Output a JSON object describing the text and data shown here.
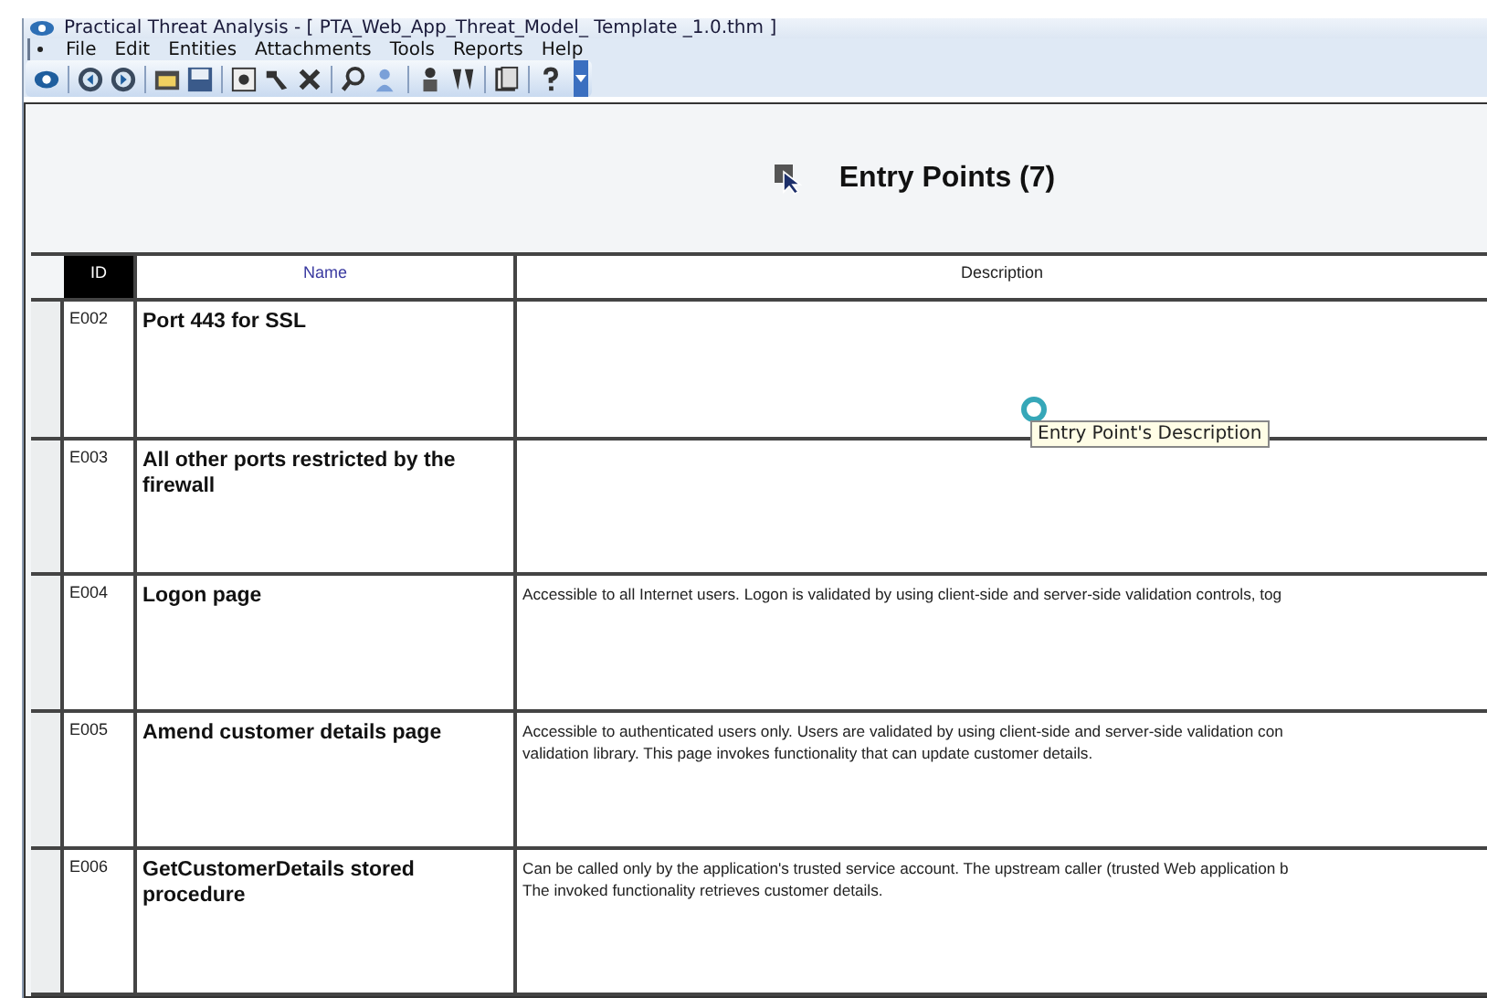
{
  "window": {
    "title": "Practical Threat Analysis - [ PTA_Web_App_Threat_Model_ Template _1.0.thm ]"
  },
  "menu": [
    "File",
    "Edit",
    "Entities",
    "Attachments",
    "Tools",
    "Reports",
    "Help"
  ],
  "panel": {
    "title": "Entry Points (7)"
  },
  "table": {
    "columns": [
      {
        "label": "ID",
        "selected": true
      },
      {
        "label": "Name",
        "selected": false
      },
      {
        "label": "Description",
        "selected": false
      }
    ],
    "rows": [
      {
        "id": "E002",
        "name": "Port 443 for SSL"
      },
      {
        "id": "E003",
        "name": "All other ports restricted by the firewall"
      },
      {
        "id": "E004",
        "name": "Logon page",
        "description": [
          "Accessible to all Internet users. Logon is validated by using client-side and server-side validation controls, tog"
        ]
      },
      {
        "id": "E005",
        "name": "Amend customer details page",
        "description": [
          "Accessible to authenticated users only. Users are validated by using client-side and server-side validation con",
          "validation library. This page invokes functionality that can update customer details."
        ]
      },
      {
        "id": "E006",
        "name": "GetCustomerDetails stored procedure",
        "description": [
          "Can be called only by the application's trusted service account. The upstream caller (trusted Web application b",
          "The invoked functionality retrieves customer details."
        ]
      }
    ]
  },
  "tooltip": {
    "text": "Entry Point's Description"
  }
}
